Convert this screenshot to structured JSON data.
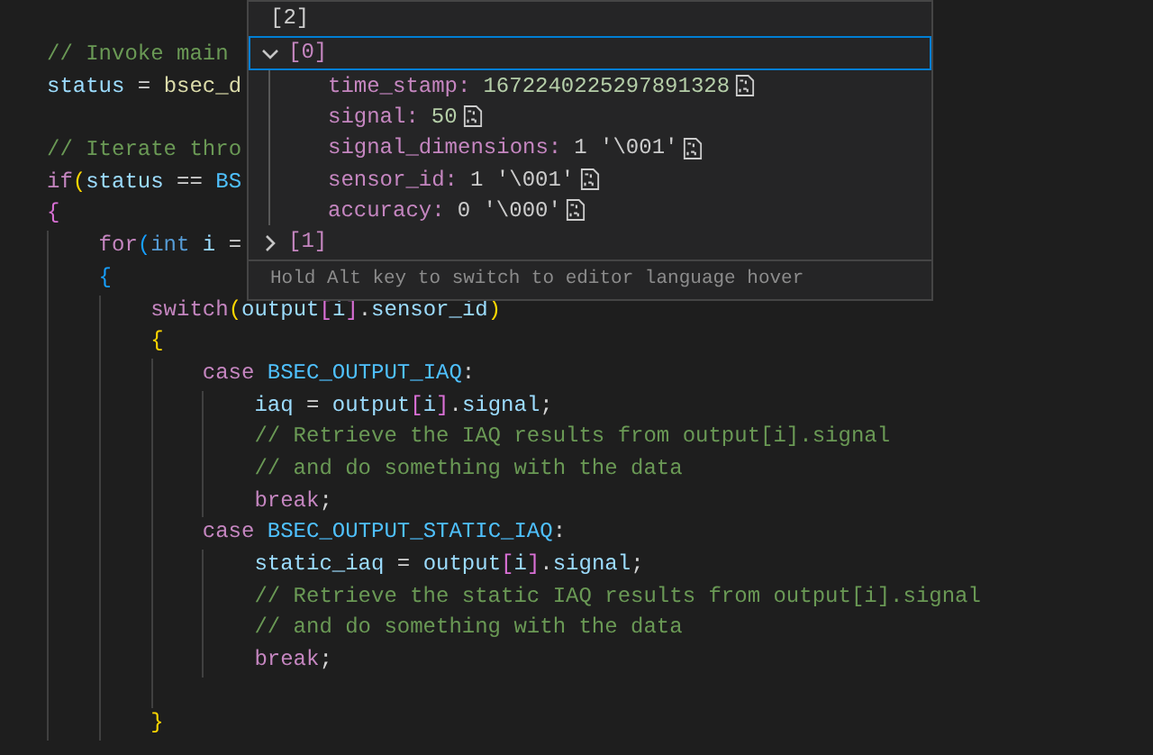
{
  "editor": {
    "lines": [
      {
        "kind": "code",
        "tokens": [
          {
            "t": "// Invoke main",
            "kind": "comment"
          }
        ]
      },
      {
        "kind": "code",
        "tokens": [
          {
            "t": "status",
            "kind": "var"
          },
          {
            "t": " = ",
            "kind": "plain"
          },
          {
            "t": "bsec_d",
            "kind": "func"
          }
        ]
      },
      {
        "kind": "blank"
      },
      {
        "kind": "code",
        "tokens": [
          {
            "t": "// Iterate thro",
            "kind": "comment"
          }
        ]
      },
      {
        "kind": "code",
        "tokens": [
          {
            "t": "if",
            "kind": "keyword"
          },
          {
            "t": "(",
            "kind": "bracket1"
          },
          {
            "t": "status",
            "kind": "var"
          },
          {
            "t": " == ",
            "kind": "plain"
          },
          {
            "t": "BS",
            "kind": "const"
          }
        ]
      },
      {
        "kind": "code",
        "tokens": [
          {
            "t": "{",
            "kind": "bracket2"
          }
        ],
        "children": [
          {
            "kind": "code",
            "tokens": [
              {
                "t": "for",
                "kind": "keyword"
              },
              {
                "t": "(",
                "kind": "bracket3"
              },
              {
                "t": "int",
                "kind": "type"
              },
              {
                "t": " i",
                "kind": "var"
              },
              {
                "t": " =",
                "kind": "plain"
              }
            ]
          },
          {
            "kind": "code",
            "tokens": [
              {
                "t": "{",
                "kind": "bracket3"
              }
            ],
            "children": [
              {
                "kind": "code",
                "tokens": [
                  {
                    "t": "switch",
                    "kind": "keyword"
                  },
                  {
                    "t": "(",
                    "kind": "bracket1"
                  },
                  {
                    "t": "output",
                    "kind": "var"
                  },
                  {
                    "t": "[",
                    "kind": "bracket2"
                  },
                  {
                    "t": "i",
                    "kind": "var"
                  },
                  {
                    "t": "]",
                    "kind": "bracket2"
                  },
                  {
                    "t": ".",
                    "kind": "plain"
                  },
                  {
                    "t": "sensor_id",
                    "kind": "var"
                  },
                  {
                    "t": ")",
                    "kind": "bracket1"
                  }
                ]
              },
              {
                "kind": "code",
                "tokens": [
                  {
                    "t": "{",
                    "kind": "bracket1"
                  }
                ],
                "children": [
                  {
                    "kind": "code",
                    "tokens": [
                      {
                        "t": "case",
                        "kind": "keyword"
                      },
                      {
                        "t": " BSEC_OUTPUT_IAQ",
                        "kind": "const"
                      },
                      {
                        "t": ":",
                        "kind": "plain"
                      }
                    ],
                    "children": [
                      {
                        "kind": "code",
                        "tokens": [
                          {
                            "t": "iaq",
                            "kind": "var"
                          },
                          {
                            "t": " = ",
                            "kind": "plain"
                          },
                          {
                            "t": "output",
                            "kind": "var"
                          },
                          {
                            "t": "[",
                            "kind": "bracket2"
                          },
                          {
                            "t": "i",
                            "kind": "var"
                          },
                          {
                            "t": "]",
                            "kind": "bracket2"
                          },
                          {
                            "t": ".",
                            "kind": "plain"
                          },
                          {
                            "t": "signal",
                            "kind": "var"
                          },
                          {
                            "t": ";",
                            "kind": "plain"
                          }
                        ]
                      },
                      {
                        "kind": "code",
                        "tokens": [
                          {
                            "t": "// Retrieve the IAQ results from output[i].signal",
                            "kind": "comment"
                          }
                        ]
                      },
                      {
                        "kind": "code",
                        "tokens": [
                          {
                            "t": "// and do something with the data",
                            "kind": "comment"
                          }
                        ]
                      },
                      {
                        "kind": "code",
                        "tokens": [
                          {
                            "t": "break",
                            "kind": "keyword"
                          },
                          {
                            "t": ";",
                            "kind": "plain"
                          }
                        ]
                      }
                    ]
                  },
                  {
                    "kind": "code",
                    "tokens": [
                      {
                        "t": "case",
                        "kind": "keyword"
                      },
                      {
                        "t": " BSEC_OUTPUT_STATIC_IAQ",
                        "kind": "const"
                      },
                      {
                        "t": ":",
                        "kind": "plain"
                      }
                    ],
                    "children": [
                      {
                        "kind": "code",
                        "tokens": [
                          {
                            "t": "static_iaq",
                            "kind": "var"
                          },
                          {
                            "t": " = ",
                            "kind": "plain"
                          },
                          {
                            "t": "output",
                            "kind": "var"
                          },
                          {
                            "t": "[",
                            "kind": "bracket2"
                          },
                          {
                            "t": "i",
                            "kind": "var"
                          },
                          {
                            "t": "]",
                            "kind": "bracket2"
                          },
                          {
                            "t": ".",
                            "kind": "plain"
                          },
                          {
                            "t": "signal",
                            "kind": "var"
                          },
                          {
                            "t": ";",
                            "kind": "plain"
                          }
                        ]
                      },
                      {
                        "kind": "code",
                        "tokens": [
                          {
                            "t": "// Retrieve the static IAQ results from output[i].signal",
                            "kind": "comment"
                          }
                        ]
                      },
                      {
                        "kind": "code",
                        "tokens": [
                          {
                            "t": "// and do something with the data",
                            "kind": "comment"
                          }
                        ]
                      },
                      {
                        "kind": "code",
                        "tokens": [
                          {
                            "t": "break",
                            "kind": "keyword"
                          },
                          {
                            "t": ";",
                            "kind": "plain"
                          }
                        ]
                      }
                    ]
                  },
                  {
                    "kind": "blank"
                  }
                ]
              },
              {
                "kind": "code",
                "tokens": [
                  {
                    "t": "}",
                    "kind": "bracket1"
                  }
                ]
              }
            ]
          }
        ]
      }
    ]
  },
  "hover": {
    "header": "[2]",
    "items": [
      {
        "label": "[0]",
        "expanded": true,
        "selected": true,
        "children": [
          {
            "name": "time_stamp:",
            "value": "1672240225297891328",
            "kind": "number"
          },
          {
            "name": "signal:",
            "value": "50",
            "kind": "number"
          },
          {
            "name": "signal_dimensions:",
            "value": "1 '\\001'",
            "kind": "char"
          },
          {
            "name": "sensor_id:",
            "value": "1 '\\001'",
            "kind": "char"
          },
          {
            "name": "accuracy:",
            "value": "0 '\\000'",
            "kind": "char"
          }
        ]
      },
      {
        "label": "[1]",
        "expanded": false,
        "selected": false
      }
    ],
    "footer": "Hold Alt key to switch to editor language hover"
  }
}
